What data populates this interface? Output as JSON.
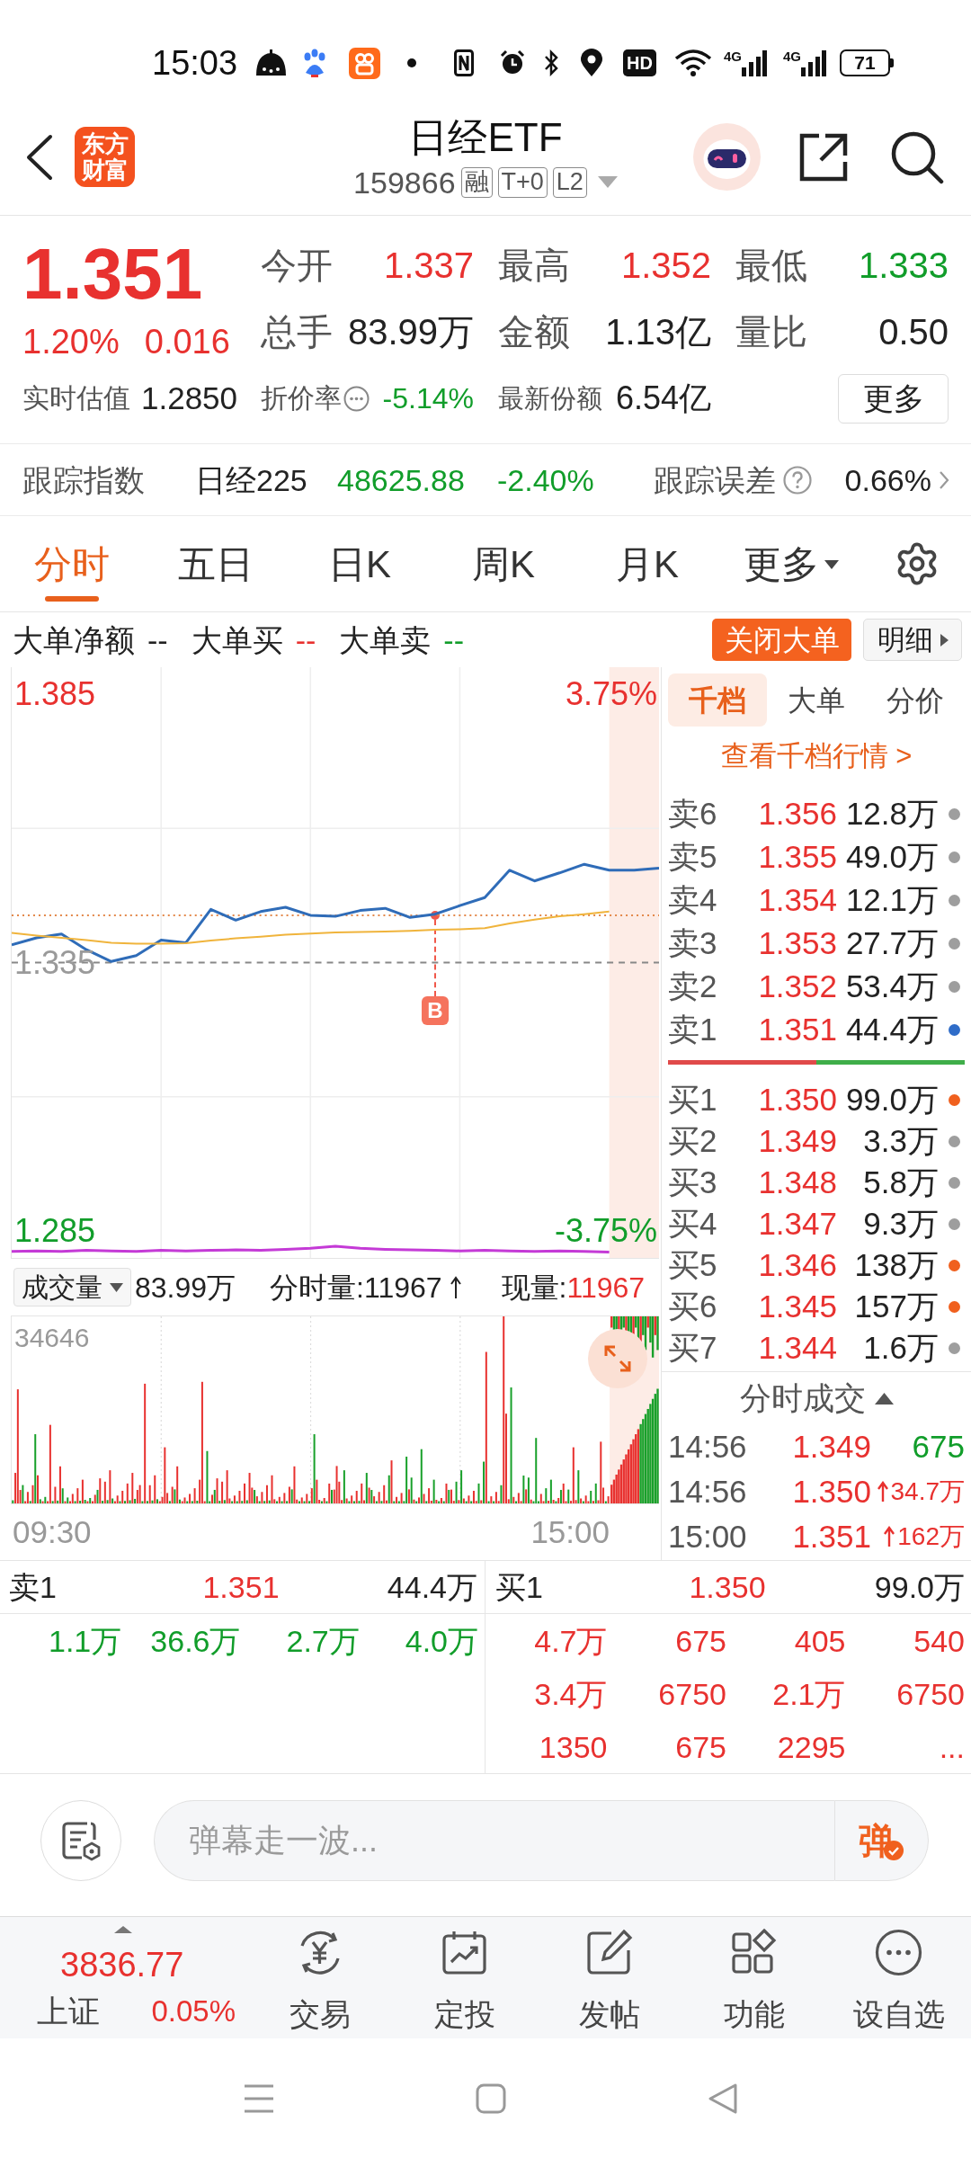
{
  "status_bar": {
    "time": "15:03",
    "hd": "HD",
    "networks": [
      "4G",
      "4G"
    ],
    "battery": "71"
  },
  "header": {
    "logo": "东方财富",
    "title": "日经ETF",
    "code": "159866",
    "badges": [
      "融",
      "T+0",
      "L2"
    ]
  },
  "quote": {
    "price": "1.351",
    "change_pct": "1.20%",
    "change": "0.016",
    "estimate": {
      "label": "实时估值",
      "value": "1.2850"
    },
    "stats": [
      {
        "label": "今开",
        "value": "1.337",
        "color": "#e8312f"
      },
      {
        "label": "最高",
        "value": "1.352",
        "color": "#e8312f"
      },
      {
        "label": "最低",
        "value": "1.333",
        "color": "#119d2a"
      },
      {
        "label": "总手",
        "value": "83.99万",
        "color": "#222222"
      },
      {
        "label": "金额",
        "value": "1.13亿",
        "color": "#222222"
      },
      {
        "label": "量比",
        "value": "0.50",
        "color": "#222222"
      }
    ],
    "discount": {
      "label": "折价率",
      "value": "-5.14%"
    },
    "shares": {
      "label": "最新份额",
      "value": "6.54亿"
    },
    "more_button": "更多"
  },
  "tracking": {
    "label": "跟踪指数",
    "index_name": "日经225",
    "index_value": "48625.88",
    "index_change": "-2.40%",
    "error_label": "跟踪误差",
    "error_value": "0.66%"
  },
  "chart_tabs": [
    {
      "label": "分时",
      "selected": true,
      "kind": "tab"
    },
    {
      "label": "五日",
      "selected": false,
      "kind": "tab"
    },
    {
      "label": "日K",
      "selected": false,
      "kind": "tab"
    },
    {
      "label": "周K",
      "selected": false,
      "kind": "tab"
    },
    {
      "label": "月K",
      "selected": false,
      "kind": "tab"
    },
    {
      "label": "更多",
      "selected": false,
      "kind": "dropdown"
    }
  ],
  "big_orders": {
    "items": [
      {
        "label": "大单净额",
        "value": "--",
        "color": "#222222"
      },
      {
        "label": "大单买",
        "value": "--",
        "color": "#e8312f"
      },
      {
        "label": "大单卖",
        "value": "--",
        "color": "#119d2a"
      }
    ],
    "close_button": "关闭大单",
    "detail_button": "明细"
  },
  "price_chart": {
    "percent_labels": [
      {
        "label": "3.75%",
        "color": "#e8312f"
      },
      {
        "label": "-3.75%",
        "color": "#119d2a"
      }
    ],
    "marker": {
      "label": "B"
    },
    "chart_data": {
      "type": "line",
      "categories": [
        null,
        null,
        null,
        null,
        null,
        null,
        null,
        null,
        null,
        null,
        null,
        null,
        null,
        null,
        null,
        null,
        null,
        null,
        null,
        null,
        null,
        null,
        null,
        null,
        null,
        null,
        null
      ],
      "series": [
        {
          "color": "#2f6cb8",
          "values": [
            1.3383,
            1.3396,
            1.3403,
            1.3374,
            1.3352,
            1.3363,
            1.3392,
            1.3387,
            1.3449,
            1.3429,
            1.3445,
            1.3453,
            1.3438,
            1.3436,
            1.3447,
            1.3451,
            1.3434,
            1.344,
            1.3456,
            1.3471,
            1.3522,
            1.3502,
            1.3517,
            1.3533,
            1.3522,
            1.3522,
            1.3526
          ]
        },
        {
          "color": "#f0b43c",
          "values": [
            1.3405,
            1.34,
            1.3396,
            1.3392,
            1.3387,
            1.3385,
            1.3385,
            1.3386,
            1.3391,
            1.3395,
            1.3398,
            1.3402,
            1.3404,
            1.3406,
            1.3407,
            1.3408,
            1.3409,
            1.3411,
            1.3412,
            1.3414,
            1.3423,
            1.343,
            1.3436,
            1.344,
            1.3445,
            null,
            null
          ]
        },
        {
          "color": "#c43ad6",
          "values": [
            1.2812,
            1.2813,
            1.2812,
            1.2814,
            1.2813,
            1.2812,
            1.2814,
            1.2813,
            1.2814,
            1.2815,
            1.2814,
            1.2816,
            1.2818,
            1.2822,
            1.2818,
            1.2816,
            1.2815,
            1.2814,
            1.2813,
            1.2814,
            1.2813,
            1.2812,
            1.2813,
            1.2812,
            1.2811,
            null,
            null
          ]
        }
      ],
      "ylim": [
        1.28,
        1.39
      ],
      "yticks": [
        {
          "value": 1.385,
          "label": "1.385"
        },
        {
          "value": 1.335,
          "label": "1.335"
        },
        {
          "value": 1.285,
          "label": "1.285"
        }
      ],
      "grid": true,
      "ref_lines": [
        {
          "axis": "y",
          "value": 1.335,
          "color": "#888888"
        },
        {
          "axis": "y",
          "value": 1.3438,
          "color": "#e3884a"
        }
      ]
    }
  },
  "volume": {
    "selector": "成交量",
    "total": "83.99万",
    "period": "分时量:11967",
    "current_label": "现量:",
    "current_value": "11967",
    "max_label": "34646",
    "time_labels": [
      "09:30",
      "15:00"
    ]
  },
  "order_book": {
    "tabs": [
      {
        "label": "千档",
        "selected": true
      },
      {
        "label": "大单",
        "selected": false
      },
      {
        "label": "分价",
        "selected": false
      }
    ],
    "link": "查看千档行情 >",
    "asks": [
      {
        "label": "卖6",
        "price": "1.356",
        "volume": "12.8万",
        "color": "#9e9e9e"
      },
      {
        "label": "卖5",
        "price": "1.355",
        "volume": "49.0万",
        "color": "#9e9e9e"
      },
      {
        "label": "卖4",
        "price": "1.354",
        "volume": "12.1万",
        "color": "#9e9e9e"
      },
      {
        "label": "卖3",
        "price": "1.353",
        "volume": "27.7万",
        "color": "#9e9e9e"
      },
      {
        "label": "卖2",
        "price": "1.352",
        "volume": "53.4万",
        "color": "#9e9e9e"
      },
      {
        "label": "卖1",
        "price": "1.351",
        "volume": "44.4万",
        "color": "#2f6cc8"
      }
    ],
    "ratio_bar": {
      "level": 0.5
    },
    "bids": [
      {
        "label": "买1",
        "price": "1.350",
        "volume": "99.0万",
        "color": "#f0601e"
      },
      {
        "label": "买2",
        "price": "1.349",
        "volume": "3.3万",
        "color": "#9e9e9e"
      },
      {
        "label": "买3",
        "price": "1.348",
        "volume": "5.8万",
        "color": "#9e9e9e"
      },
      {
        "label": "买4",
        "price": "1.347",
        "volume": "9.3万",
        "color": "#9e9e9e"
      },
      {
        "label": "买5",
        "price": "1.346",
        "volume": "138万",
        "color": "#f0601e"
      },
      {
        "label": "买6",
        "price": "1.345",
        "volume": "157万",
        "color": "#f0601e"
      },
      {
        "label": "买7",
        "price": "1.344",
        "volume": "1.6万",
        "color": "#9e9e9e"
      }
    ]
  },
  "trades": {
    "title": "分时成交",
    "rows": [
      {
        "time": "14:56",
        "price": "1.349",
        "volume": "675",
        "kind": "sell"
      },
      {
        "time": "14:56",
        "price": "1.350",
        "volume": "34.7万",
        "kind": "buy"
      },
      {
        "time": "15:00",
        "price": "1.351",
        "volume": "162万",
        "kind": "buy"
      }
    ]
  },
  "level2": {
    "ask": {
      "label": "卖1",
      "price": "1.351",
      "volume": "44.4万",
      "orders": [
        "1.1万",
        "36.6万",
        "2.7万",
        "4.0万"
      ]
    },
    "bid": {
      "label": "买1",
      "price": "1.350",
      "volume": "99.0万",
      "orders": [
        "4.7万",
        "675",
        "405",
        "540",
        "3.4万",
        "6750",
        "2.1万",
        "6750",
        "1350",
        "675",
        "2295",
        "..."
      ]
    }
  },
  "comment_bar": {
    "placeholder": "弹幕走一波...",
    "send_label": "弹"
  },
  "bottom_nav": {
    "index": {
      "value": "3836.77",
      "name": "上证",
      "change": "0.05%"
    },
    "items": [
      {
        "label": "交易",
        "kind": "trade"
      },
      {
        "label": "定投",
        "kind": "plan"
      },
      {
        "label": "发帖",
        "kind": "post"
      },
      {
        "label": "功能",
        "kind": "apps"
      },
      {
        "label": "设自选",
        "kind": "more"
      }
    ]
  }
}
